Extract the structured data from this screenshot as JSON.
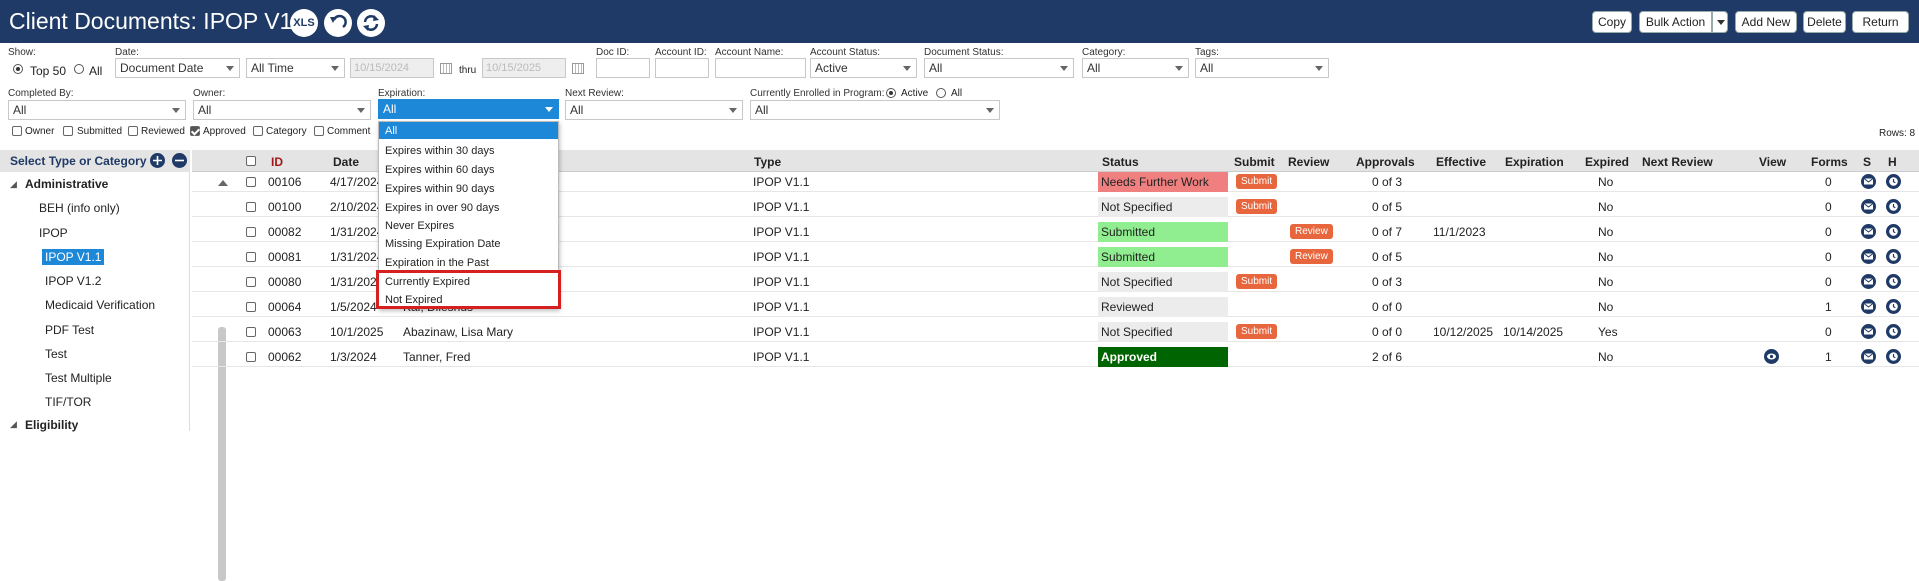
{
  "header": {
    "title": "Client Documents: IPOP V1.1",
    "xls_label": "XLS",
    "buttons": {
      "copy": "Copy",
      "bulk": "Bulk Action",
      "add": "Add New",
      "delete": "Delete",
      "return": "Return"
    }
  },
  "filters": {
    "show": {
      "label": "Show:",
      "top50": "Top 50",
      "all": "All"
    },
    "date": {
      "label": "Date:",
      "field": "Document Date",
      "range": "All Time",
      "from": "10/15/2024",
      "thru": "thru",
      "to": "10/15/2025"
    },
    "doc_id": {
      "label": "Doc ID:",
      "value": ""
    },
    "account_id": {
      "label": "Account ID:",
      "value": ""
    },
    "account_name": {
      "label": "Account Name:",
      "value": ""
    },
    "account_status": {
      "label": "Account Status:",
      "value": "Active"
    },
    "document_status": {
      "label": "Document Status:",
      "value": "All"
    },
    "category": {
      "label": "Category:",
      "value": "All"
    },
    "tags": {
      "label": "Tags:",
      "value": "All"
    },
    "completed_by": {
      "label": "Completed By:",
      "value": "All"
    },
    "owner": {
      "label": "Owner:",
      "value": "All"
    },
    "expiration": {
      "label": "Expiration:",
      "value": "All"
    },
    "next_review": {
      "label": "Next Review:",
      "value": "All"
    },
    "enrolled": {
      "label": "Currently Enrolled in Program:",
      "active": "Active",
      "all": "All",
      "value": "All"
    },
    "checks": [
      "Owner",
      "Submitted",
      "Reviewed",
      "Approved",
      "Category",
      "Comment"
    ],
    "rows_count": "Rows: 8"
  },
  "expiration_options": [
    "All",
    "Expires within 30 days",
    "Expires within 60 days",
    "Expires within 90 days",
    "Expires in over 90 days",
    "Never Expires",
    "Missing Expiration Date",
    "Expiration in the Past",
    "Currently Expired",
    "Not Expired"
  ],
  "sidebar": {
    "title": "Select Type or Category",
    "groups": [
      {
        "name": "Administrative",
        "items": [
          "BEH (info only)",
          "IPOP",
          "IPOP V1.1",
          "IPOP V1.2",
          "Medicaid Verification",
          "PDF Test",
          "Test",
          "Test Multiple",
          "TIF/TOR"
        ]
      },
      {
        "name": "Eligibility",
        "items": []
      }
    ]
  },
  "table": {
    "columns": [
      "ID",
      "Date",
      "Type",
      "Status",
      "Submit",
      "Review",
      "Approvals",
      "Effective",
      "Expiration",
      "Expired",
      "Next Review",
      "View",
      "Forms",
      "S",
      "H"
    ],
    "rows": [
      {
        "id": "00106",
        "date": "4/17/2024",
        "name": "",
        "type": "IPOP V1.1",
        "status": "Needs Further Work",
        "submit": "Submit",
        "review": "",
        "approvals": "0 of 3",
        "effective": "",
        "expiration": "",
        "expired": "No",
        "forms": "0"
      },
      {
        "id": "00100",
        "date": "2/10/2024",
        "name": "",
        "type": "IPOP V1.1",
        "status": "Not Specified",
        "submit": "Submit",
        "review": "",
        "approvals": "0 of 5",
        "effective": "",
        "expiration": "",
        "expired": "No",
        "forms": "0"
      },
      {
        "id": "00082",
        "date": "1/31/2024",
        "name": "",
        "type": "IPOP V1.1",
        "status": "Submitted",
        "submit": "",
        "review": "Review",
        "approvals": "0 of 7",
        "effective": "11/1/2023",
        "expiration": "",
        "expired": "No",
        "forms": "0"
      },
      {
        "id": "00081",
        "date": "1/31/2024",
        "name": "",
        "type": "IPOP V1.1",
        "status": "Submitted",
        "submit": "",
        "review": "Review",
        "approvals": "0 of 5",
        "effective": "",
        "expiration": "",
        "expired": "No",
        "forms": "0"
      },
      {
        "id": "00080",
        "date": "1/31/2024",
        "name": "",
        "type": "IPOP V1.1",
        "status": "Not Specified",
        "submit": "Submit",
        "review": "",
        "approvals": "0 of 3",
        "effective": "",
        "expiration": "",
        "expired": "No",
        "forms": "0"
      },
      {
        "id": "00064",
        "date": "1/5/2024",
        "name": "Kai, Dileshus",
        "type": "IPOP V1.1",
        "status": "Reviewed",
        "submit": "",
        "review": "",
        "approvals": "0 of 0",
        "effective": "",
        "expiration": "",
        "expired": "No",
        "forms": "1"
      },
      {
        "id": "00063",
        "date": "10/1/2025",
        "name": "Abazinaw, Lisa Mary",
        "type": "IPOP V1.1",
        "status": "Not Specified",
        "submit": "Submit",
        "review": "",
        "approvals": "0 of 0",
        "effective": "10/12/2025",
        "expiration": "10/14/2025",
        "expired": "Yes",
        "forms": "0"
      },
      {
        "id": "00062",
        "date": "1/3/2024",
        "name": "Tanner, Fred",
        "type": "IPOP V1.1",
        "status": "Approved",
        "submit": "",
        "review": "",
        "approvals": "2 of 6",
        "effective": "",
        "expiration": "",
        "expired": "No",
        "forms": "1"
      }
    ]
  },
  "colors": {
    "header": "#1f3a66",
    "accent": "#1e88d8",
    "needs_work": "#f08080",
    "submitted": "#90ee90",
    "approved": "#006400",
    "reviewed": "#ececec",
    "submit_badge": "#e8663d",
    "highlight": "#d62020"
  },
  "icons": [
    "xls-icon",
    "undo-icon",
    "refresh-icon",
    "calendar-icon",
    "expand-icon",
    "collapse-icon",
    "email-icon",
    "history-icon",
    "view-icon"
  ]
}
